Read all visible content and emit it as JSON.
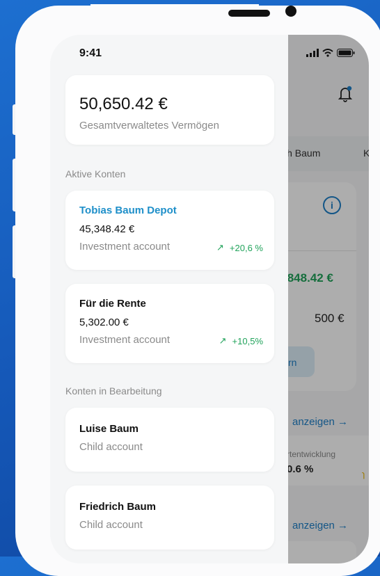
{
  "status": {
    "time": "9:41"
  },
  "total": {
    "value": "50,650.42 €",
    "label": "Gesamtverwaltetes Vermögen"
  },
  "sections": {
    "active": "Aktive Konten",
    "pending": "Konten in Bearbeitung"
  },
  "accounts": [
    {
      "name": "Tobias Baum Depot",
      "value": "45,348.42 €",
      "type": "Investment account",
      "change": "+20,6 %"
    },
    {
      "name": "Für die Rente",
      "value": "5,302.00 €",
      "type": "Investment account",
      "change": "+10,5%"
    }
  ],
  "children": [
    {
      "name": "Luise Baum",
      "type": "Child account"
    },
    {
      "name": "Friedrich Baum",
      "type": "Child account"
    }
  ],
  "background": {
    "tab1": "ich Baum",
    "tab2": "K",
    "value_green": ",848.42 €",
    "value_500": "500 €",
    "button_text": "rn",
    "link1": "anzeigen →",
    "small_label": "rtentwicklung",
    "percent": "0.6 %",
    "link2": "anzeigen →"
  },
  "colors": {
    "accent": "#1e8fc9",
    "positive": "#21a35b",
    "background": "#1558b8"
  },
  "icons": [
    "bell-icon",
    "info-icon",
    "trend-up-icon",
    "signal-icon",
    "wifi-icon",
    "battery-icon"
  ]
}
